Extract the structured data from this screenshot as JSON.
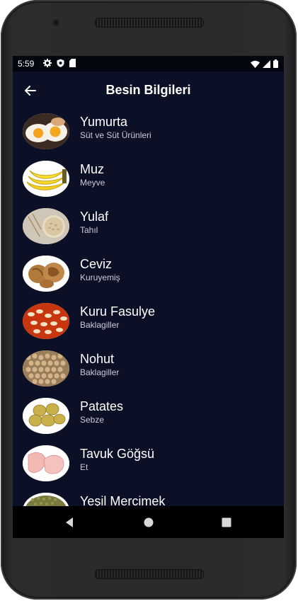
{
  "status": {
    "time": "5:59"
  },
  "appbar": {
    "title": "Besin Bilgileri"
  },
  "foods": [
    {
      "name": "Yumurta",
      "category": "Süt ve Süt Ürünleri",
      "icon": "egg-image"
    },
    {
      "name": "Muz",
      "category": "Meyve",
      "icon": "banana-image"
    },
    {
      "name": "Yulaf",
      "category": "Tahıl",
      "icon": "oats-image"
    },
    {
      "name": "Ceviz",
      "category": "Kuruyemiş",
      "icon": "walnut-image"
    },
    {
      "name": "Kuru Fasulye",
      "category": "Baklagiller",
      "icon": "bean-image"
    },
    {
      "name": "Nohut",
      "category": "Baklagiller",
      "icon": "chickpea-image"
    },
    {
      "name": "Patates",
      "category": "Sebze",
      "icon": "potato-image"
    },
    {
      "name": "Tavuk Göğsü",
      "category": "Et",
      "icon": "chicken-breast-image"
    },
    {
      "name": "Yeşil Mercimek",
      "category": "",
      "icon": "lentil-image"
    }
  ],
  "colors": {
    "background": "#0c1027",
    "statusbar": "#03050f",
    "text": "#ffffff",
    "subtext": "#c9ccd6"
  }
}
